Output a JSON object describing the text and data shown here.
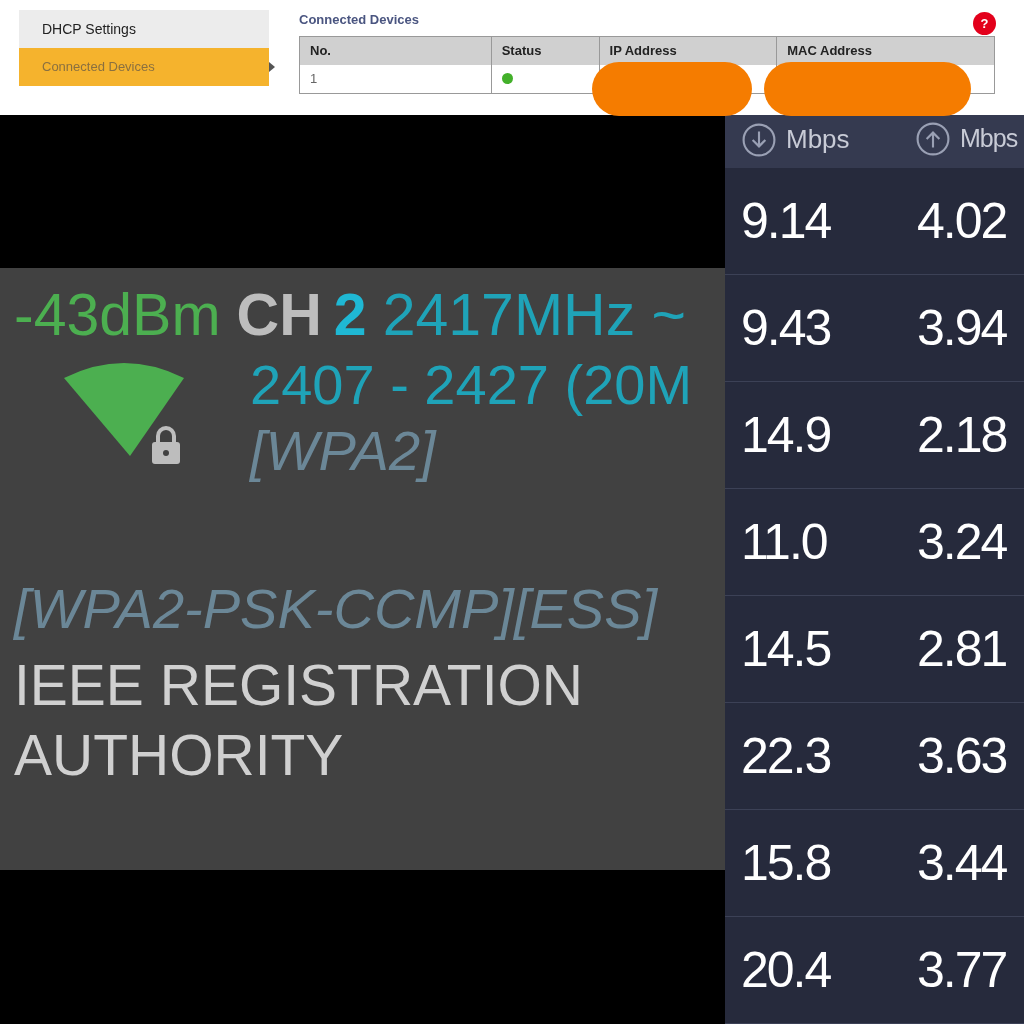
{
  "router_page": {
    "sidebar": [
      {
        "label": "DHCP Settings",
        "selected": false
      },
      {
        "label": "Connected Devices",
        "selected": true
      }
    ],
    "section_title": "Connected Devices",
    "help": "?",
    "table": {
      "columns": [
        "No.",
        "Status",
        "IP Address",
        "MAC Address"
      ],
      "rows": [
        {
          "no": "1",
          "color": "#43b02a",
          "redacted": true
        }
      ]
    }
  },
  "wifi_panel": {
    "signal": "-43dBm",
    "channel_label": "CH",
    "channel": "2",
    "frequency": "2417MHz ~",
    "range": "2407 - 2427 (20M",
    "security_short": "[WPA2]",
    "capabilities": "[WPA2-PSK-CCMP][ESS]",
    "vendor": "IEEE REGISTRATION AUTHORITY",
    "locked": true
  },
  "speed_log": {
    "download_header": "Mbps",
    "upload_header": "Mbps",
    "rows": [
      [
        "9.14",
        "4.02"
      ],
      [
        "9.43",
        "3.94"
      ],
      [
        "14.9",
        "2.18"
      ],
      [
        "11.0",
        "3.24"
      ],
      [
        "14.5",
        "2.81"
      ],
      [
        "22.3",
        "3.63"
      ],
      [
        "15.8",
        "3.44"
      ],
      [
        "20.4",
        "3.77"
      ]
    ]
  }
}
